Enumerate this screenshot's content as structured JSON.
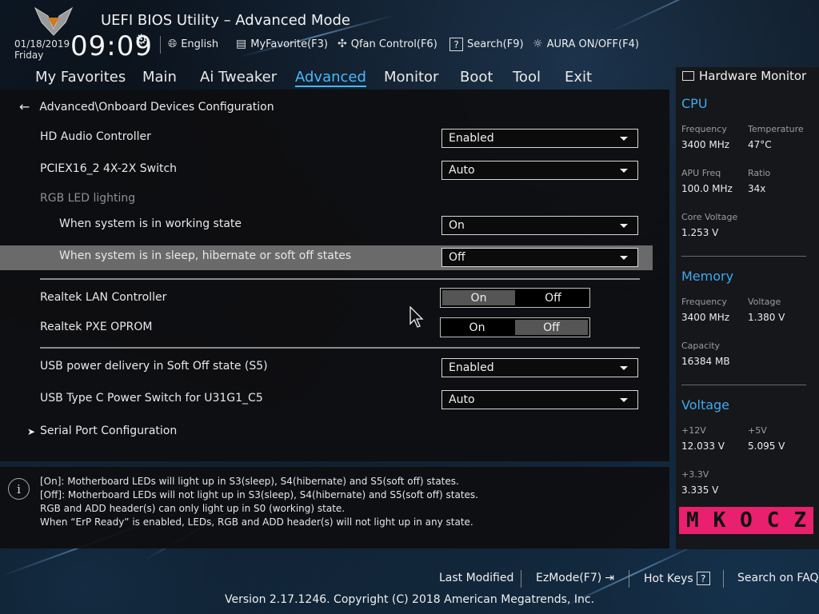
{
  "header": {
    "title": "UEFI BIOS Utility – Advanced Mode",
    "date": "01/18/2019",
    "day": "Friday",
    "time": "09:09",
    "tools": {
      "language": "English",
      "myfavorite": "MyFavorite(F3)",
      "qfan": "Qfan Control(F6)",
      "search": "Search(F9)",
      "aura": "AURA ON/OFF(F4)"
    }
  },
  "menu": {
    "items": [
      "My Favorites",
      "Main",
      "Ai Tweaker",
      "Advanced",
      "Monitor",
      "Boot",
      "Tool",
      "Exit"
    ],
    "active": "Advanced"
  },
  "main": {
    "breadcrumb": "Advanced\\Onboard Devices Configuration",
    "hd_audio": {
      "label": "HD Audio Controller",
      "value": "Enabled"
    },
    "pciex16": {
      "label": "PCIEX16_2 4X-2X Switch",
      "value": "Auto"
    },
    "rgb_heading": "RGB LED lighting",
    "rgb_working": {
      "label": "When system is in working state",
      "value": "On"
    },
    "rgb_sleep": {
      "label": "When system is in sleep, hibernate or soft off states",
      "value": "Off"
    },
    "lan": {
      "label": "Realtek LAN Controller",
      "on": "On",
      "off": "Off",
      "selected": "On"
    },
    "pxe": {
      "label": "Realtek PXE OPROM",
      "on": "On",
      "off": "Off",
      "selected": "Off"
    },
    "usb_power": {
      "label": "USB power delivery in Soft Off state (S5)",
      "value": "Enabled"
    },
    "usb_typec": {
      "label": "USB Type C Power Switch for U31G1_C5",
      "value": "Auto"
    },
    "serial": "Serial Port Configuration"
  },
  "info": {
    "lines": [
      "[On]: Motherboard LEDs will light up in S3(sleep), S4(hibernate) and S5(soft off) states.",
      "[Off]: Motherboard LEDs will not light up in S3(sleep), S4(hibernate) and S5(soft off) states.",
      "RGB and ADD header(s) can only light up in S0 (working) state.",
      "When “ErP Ready” is enabled, LEDs, RGB and ADD header(s) will not light up in any state."
    ]
  },
  "hw": {
    "title": "Hardware Monitor",
    "cpu": {
      "heading": "CPU",
      "freq_label": "Frequency",
      "freq": "3400 MHz",
      "temp_label": "Temperature",
      "temp": "47°C",
      "apu_label": "APU Freq",
      "apu": "100.0 MHz",
      "ratio_label": "Ratio",
      "ratio": "34x",
      "vcore_label": "Core Voltage",
      "vcore": "1.253 V"
    },
    "memory": {
      "heading": "Memory",
      "freq_label": "Frequency",
      "freq": "3400 MHz",
      "volt_label": "Voltage",
      "volt": "1.380 V",
      "cap_label": "Capacity",
      "cap": "16384 MB"
    },
    "voltage": {
      "heading": "Voltage",
      "v12_label": "+12V",
      "v12": "12.033 V",
      "v5_label": "+5V",
      "v5": "5.095 V",
      "v33_label": "+3.3V",
      "v33": "3.335 V"
    },
    "watermark": [
      "M",
      "K",
      "O",
      "C",
      "Z"
    ]
  },
  "footer": {
    "last_modified": "Last Modified",
    "ezmode": "EzMode(F7)",
    "hotkeys": "Hot Keys",
    "hotkeys_key": "?",
    "faq": "Search on FAQ",
    "version": "Version 2.17.1246. Copyright (C) 2018 American Megatrends, Inc."
  },
  "colors": {
    "accent": "#48b8ff",
    "section": "#3ea9ef",
    "watermark": "#e8206e"
  }
}
